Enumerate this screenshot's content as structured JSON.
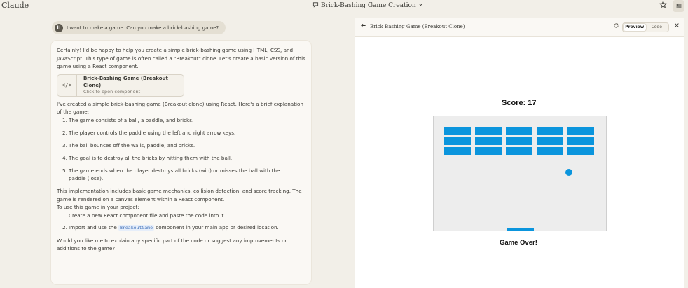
{
  "app": {
    "brand": "Claude",
    "conversation_title": "Brick-Bashing Game Creation"
  },
  "user_message": {
    "avatar_initial": "H",
    "text": "I want to make a game. Can you make a brick-bashing game?"
  },
  "assistant_reply": {
    "intro": "Certainly! I'd be happy to help you create a simple brick-bashing game using HTML, CSS, and JavaScript. This type of game is often called a \"Breakout\" clone. Let's create a basic version of this game using a React component.",
    "artifact": {
      "title": "Brick-Bashing Game (Breakout Clone)",
      "subtitle": "Click to open component"
    },
    "explanation": "I've created a simple brick-bashing game (Breakout clone) using React. Here's a brief explanation of the game:",
    "steps": [
      "The game consists of a ball, a paddle, and bricks.",
      "The player controls the paddle using the left and right arrow keys.",
      "The ball bounces off the walls, paddle, and bricks.",
      "The goal is to destroy all the bricks by hitting them with the ball.",
      "The game ends when the player destroys all bricks (win) or misses the ball with the paddle (lose)."
    ],
    "implementation_note": "This implementation includes basic game mechanics, collision detection, and score tracking. The game is rendered on a canvas element within a React component.",
    "usage_intro": "To use this game in your project:",
    "usage_steps": {
      "step1": "Create a new React component file and paste the code into it.",
      "step2_before": "Import and use the ",
      "step2_code": "BreakoutGame",
      "step2_after": " component in your main app or desired location."
    },
    "closing": "Would you like me to explain any specific part of the code or suggest any improvements or additions to the game?"
  },
  "artifact_panel": {
    "title": "Brick Bashing Game (Breakout Clone)",
    "tabs": {
      "preview": "Preview",
      "code": "Code"
    },
    "active_tab": "Preview"
  },
  "game": {
    "score_text": "Score: 17",
    "game_over_text": "Game Over!",
    "brick_rows": 3,
    "brick_columns": 5,
    "brick_color": "#0b95dd"
  },
  "icons": [
    "chat-icon",
    "chevron-down-icon",
    "star-icon",
    "menu-icon",
    "code-icon",
    "back-arrow-icon",
    "refresh-icon",
    "close-icon"
  ]
}
